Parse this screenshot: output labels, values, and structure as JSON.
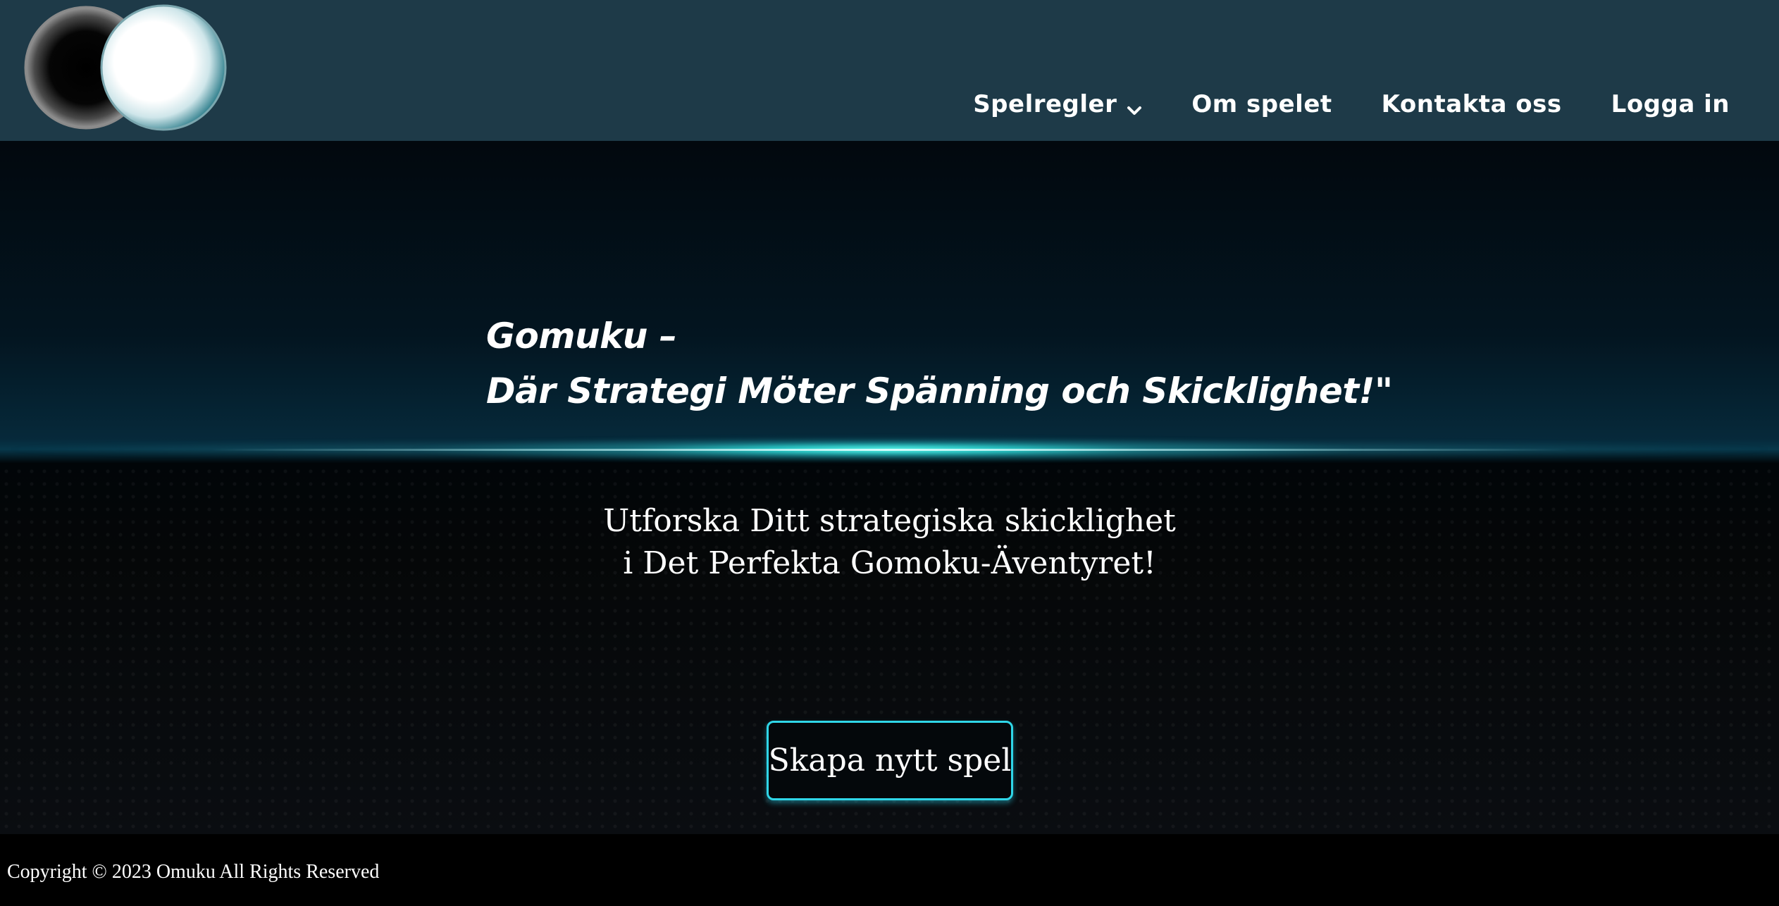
{
  "header": {
    "logo_icon": "two-stones-logo-icon",
    "nav": [
      {
        "label": "Spelregler",
        "has_dropdown": true,
        "icon": "chevron-down-icon"
      },
      {
        "label": "Om spelet"
      },
      {
        "label": "Kontakta oss"
      },
      {
        "label": "Logga in"
      }
    ]
  },
  "hero": {
    "title_line1": "Gomuku –",
    "title_line2": "Där Strategi Möter Spänning och Skicklighet!\"",
    "subtitle_line1": "Utforska Ditt strategiska skicklighet",
    "subtitle_line2": "i Det Perfekta Gomoku-Äventyret!",
    "cta_label": "Skapa nytt spel"
  },
  "footer": {
    "copyright": "Copyright © 2023 Omuku All Rights Reserved"
  },
  "colors": {
    "header_bg": "#1e3a48",
    "accent": "#2fd6e8",
    "footer_bg": "#000000",
    "text": "#ffffff"
  }
}
